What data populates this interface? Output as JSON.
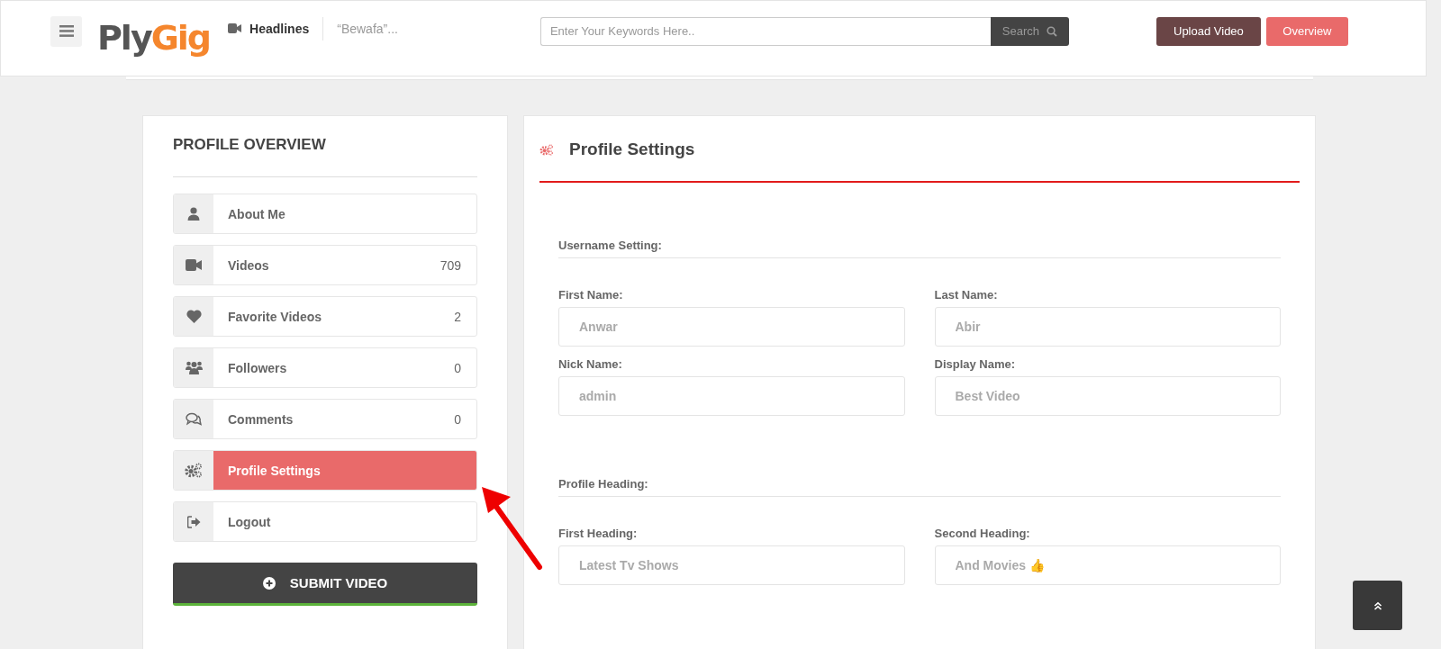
{
  "header": {
    "logo": {
      "first": "Ply",
      "second": "Gig"
    },
    "headlines": {
      "label": "Headlines",
      "ticker": "“Bewafa”..."
    },
    "search": {
      "placeholder": "Enter Your Keywords Here..",
      "button": "Search"
    },
    "buttons": [
      {
        "label": "Upload Video",
        "kind": "dark"
      },
      {
        "label": "Overview",
        "kind": "accent"
      }
    ]
  },
  "sidebar": {
    "title": "PROFILE OVERVIEW",
    "items": [
      {
        "label": "About Me",
        "selected": false
      },
      {
        "label": "Videos",
        "count": "709",
        "selected": false
      },
      {
        "label": "Favorite Videos",
        "count": "2",
        "selected": false
      },
      {
        "label": "Followers",
        "count": "0",
        "selected": false
      },
      {
        "label": "Comments",
        "count": "0",
        "selected": false
      },
      {
        "label": "Profile Settings",
        "selected": true
      },
      {
        "label": "Logout",
        "selected": false
      }
    ],
    "submit": "SUBMIT VIDEO"
  },
  "settings": {
    "title": "Profile Settings",
    "sections": [
      {
        "title": "Username Setting:",
        "fields": [
          {
            "label": "First Name:",
            "value": "Anwar"
          },
          {
            "label": "Last Name:",
            "value": "Abir"
          },
          {
            "label": "Nick Name:",
            "value": "admin"
          },
          {
            "label": "Display Name:",
            "value": "Best Video"
          }
        ]
      },
      {
        "title": "Profile Heading:",
        "fields": [
          {
            "label": "First Heading:",
            "value": "Latest Tv Shows"
          },
          {
            "label": "Second Heading:",
            "value": "And Movies 👍"
          }
        ]
      }
    ]
  }
}
